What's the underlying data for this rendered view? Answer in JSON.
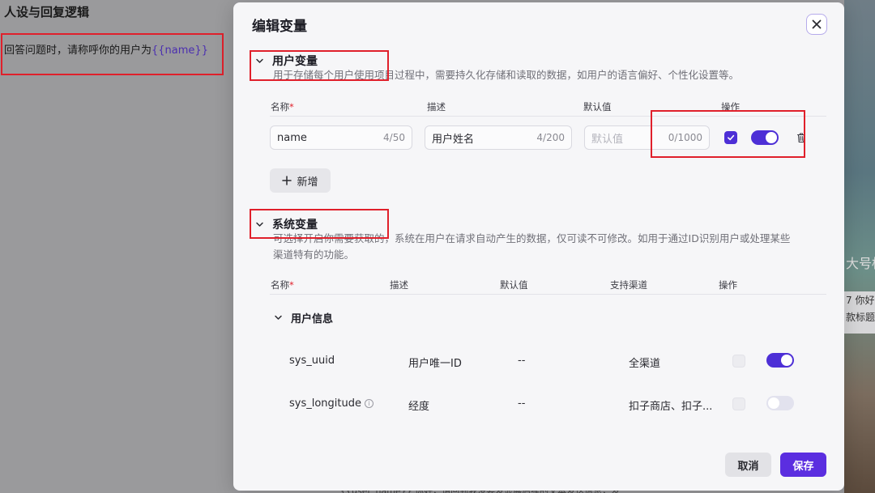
{
  "background": {
    "left_title": "人设与回复逻辑",
    "left_text_prefix": "回答问题时，请称呼你的用户为",
    "left_text_var": "{{name}}",
    "right_text_1": "大号标",
    "right_text_2": "7 你好",
    "right_text_3": "款标题",
    "bottom_text": "{{user_name}} 你好，请回到我没要发显展后续的文本发送信息，发"
  },
  "modal": {
    "title": "编辑变量",
    "user_vars": {
      "title": "用户变量",
      "description": "用于存储每个用户使用项目过程中，需要持久化存储和读取的数据，如用户的语言偏好、个性化设置等。",
      "columns": {
        "name": "名称",
        "required_mark": "*",
        "desc": "描述",
        "default": "默认值",
        "action": "操作"
      },
      "rows": [
        {
          "name": "name",
          "name_count": "4/50",
          "desc": "用户姓名",
          "desc_count": "4/200",
          "default_placeholder": "默认值",
          "default_count": "0/1000",
          "checked": true,
          "enabled": true
        }
      ],
      "add_label": "新增"
    },
    "system_vars": {
      "title": "系统变量",
      "description_line1": "可选择开启你需要获取的，系统在用户在请求自动产生的数据，仅可读不可修改。如用于通过ID识别用户或处理某些",
      "description_line2": "渠道特有的功能。",
      "columns": {
        "name": "名称",
        "required_mark": "*",
        "desc": "描述",
        "default": "默认值",
        "channel": "支持渠道",
        "action": "操作"
      },
      "group_title": "用户信息",
      "rows": [
        {
          "name": "sys_uuid",
          "desc": "用户唯一ID",
          "default": "--",
          "channel": "全渠道",
          "enabled": true
        },
        {
          "name": "sys_longitude",
          "desc": "经度",
          "default": "--",
          "channel": "扣子商店、扣子...",
          "enabled": false
        }
      ]
    },
    "cancel_label": "取消",
    "save_label": "保存"
  },
  "colors": {
    "accent": "#4d2fd6",
    "save": "#5b2ee0",
    "annotation": "#e0202b"
  }
}
